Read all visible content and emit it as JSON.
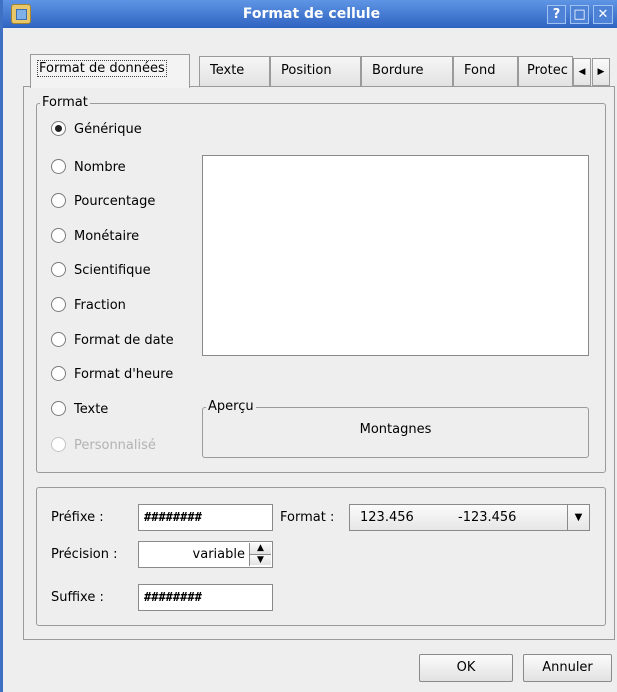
{
  "window": {
    "title": "Format de cellule",
    "controls": {
      "help": "?",
      "maximize": "□",
      "close": "✕"
    }
  },
  "tabs": [
    {
      "label": "Format de données",
      "mnemonic": "o"
    },
    {
      "label": "Texte",
      "mnemonic": "T"
    },
    {
      "label": "Position",
      "mnemonic": "P"
    },
    {
      "label": "Bordure",
      "mnemonic": "B"
    },
    {
      "label": "Fond",
      "mnemonic": "F"
    },
    {
      "label": "Protec"
    }
  ],
  "tab_scroll": {
    "left": "◀",
    "right": "▶"
  },
  "format_group": {
    "legend": "Format",
    "options": [
      {
        "label": "Générique",
        "selected": true
      },
      {
        "label": "Nombre"
      },
      {
        "label": "Pourcentage"
      },
      {
        "label": "Monétaire"
      },
      {
        "label": "Scientifique"
      },
      {
        "label": "Fraction"
      },
      {
        "label": "Format de date"
      },
      {
        "label": "Format d'heure"
      },
      {
        "label": "Texte"
      },
      {
        "label": "Personnalisé",
        "disabled": true
      }
    ]
  },
  "preview": {
    "legend": "Aperçu",
    "text": "Montagnes"
  },
  "options_group": {
    "prefix_label": "Préfixe :",
    "prefix_value": "########",
    "precision_label": "Précision :",
    "precision_value": "variable",
    "suffix_label": "Suffixe :",
    "suffix_value": "########",
    "format_label": "Format :",
    "format_value_positive": "123.456",
    "format_value_negative": "-123.456",
    "spin_up": "▲",
    "spin_down": "▼",
    "combo_arrow": "▼"
  },
  "buttons": {
    "ok": "OK",
    "cancel": "Annuler"
  }
}
